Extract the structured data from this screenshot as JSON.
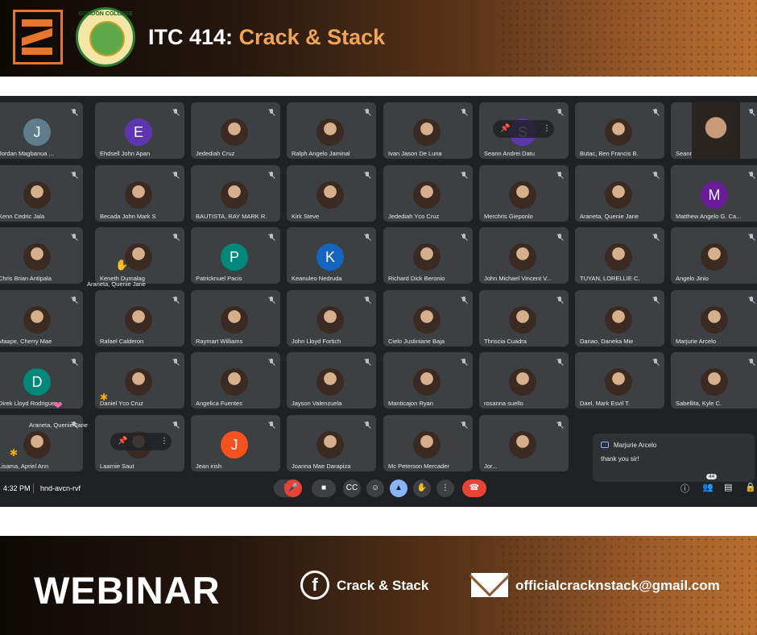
{
  "header": {
    "title_prefix": "ITC 414:",
    "title_accent": "Crack & Stack",
    "seal_text": "GORDON COLLEGE"
  },
  "participants": [
    {
      "name": "Jordan Magbanua ...",
      "initial": "J",
      "color": "#5f7d8c",
      "photo": false
    },
    {
      "name": "Ehdsell John Apan",
      "initial": "E",
      "color": "#5e35b1",
      "photo": false
    },
    {
      "name": "Jedediah Cruz",
      "initial": "",
      "color": "",
      "photo": true
    },
    {
      "name": "Ralph Angelo Jaminal",
      "initial": "",
      "color": "",
      "photo": true
    },
    {
      "name": "Ivan Jason De Luna",
      "initial": "",
      "color": "",
      "photo": true
    },
    {
      "name": "Seann Andrei Datu",
      "initial": "S",
      "color": "#5e35b1",
      "photo": false
    },
    {
      "name": "Butac, Ben Francis B.",
      "initial": "",
      "color": "",
      "photo": true
    },
    {
      "name": "Seann Andrei Datu",
      "initial": "",
      "color": "",
      "photo": true
    },
    {
      "name": "Kenn Cedric Jala",
      "initial": "",
      "color": "",
      "photo": true
    },
    {
      "name": "Becada John Mark S",
      "initial": "",
      "color": "",
      "photo": true
    },
    {
      "name": "BAUTISTA, RAY MARK R.",
      "initial": "",
      "color": "",
      "photo": true
    },
    {
      "name": "Kirk Steve",
      "initial": "",
      "color": "",
      "photo": true
    },
    {
      "name": "Jedediah Yco Cruz",
      "initial": "",
      "color": "",
      "photo": true
    },
    {
      "name": "Merchris Gieponlo",
      "initial": "",
      "color": "",
      "photo": true
    },
    {
      "name": "Araneta, Quenie Jane",
      "initial": "",
      "color": "",
      "photo": true
    },
    {
      "name": "Matthew Angelo G. Ca...",
      "initial": "M",
      "color": "#6a1b9a",
      "photo": false
    },
    {
      "name": "Chris Brian Antipala",
      "initial": "",
      "color": "",
      "photo": true
    },
    {
      "name": "Keneth Dumalag",
      "initial": "",
      "color": "",
      "photo": true
    },
    {
      "name": "Patricknuel Pacis",
      "initial": "P",
      "color": "#00897b",
      "photo": false
    },
    {
      "name": "Keanuleo Nedruda",
      "initial": "K",
      "color": "#1565c0",
      "photo": false
    },
    {
      "name": "Richard Dick Beronio",
      "initial": "",
      "color": "",
      "photo": true
    },
    {
      "name": "John Michael Vincent V...",
      "initial": "",
      "color": "",
      "photo": true
    },
    {
      "name": "TUYAN, LORELLIE C.",
      "initial": "",
      "color": "",
      "photo": true
    },
    {
      "name": "Angelo Jinio",
      "initial": "",
      "color": "",
      "photo": true
    },
    {
      "name": "Maape, Cherry Mae",
      "initial": "",
      "color": "",
      "photo": true
    },
    {
      "name": "Rafael Calderon",
      "initial": "",
      "color": "",
      "photo": true
    },
    {
      "name": "Raymart Williams",
      "initial": "",
      "color": "",
      "photo": true
    },
    {
      "name": "John Lloyd Fortich",
      "initial": "",
      "color": "",
      "photo": true
    },
    {
      "name": "Cielo Justiniane Baja",
      "initial": "",
      "color": "",
      "photo": true
    },
    {
      "name": "Thriscia Cuadra",
      "initial": "",
      "color": "",
      "photo": true
    },
    {
      "name": "Danao, Daneka Mie",
      "initial": "",
      "color": "",
      "photo": true
    },
    {
      "name": "Marjurie Arcelo",
      "initial": "",
      "color": "",
      "photo": true
    },
    {
      "name": "Direk Lloyd Rodriguez",
      "initial": "D",
      "color": "#00897b",
      "photo": false
    },
    {
      "name": "Daniel Yco Cruz",
      "initial": "",
      "color": "",
      "photo": true
    },
    {
      "name": "Angelica Fuentes",
      "initial": "",
      "color": "",
      "photo": true
    },
    {
      "name": "Jayson Valenzuela",
      "initial": "",
      "color": "",
      "photo": true
    },
    {
      "name": "Manticajon Ryan",
      "initial": "",
      "color": "",
      "photo": true
    },
    {
      "name": "rosanna suello",
      "initial": "",
      "color": "",
      "photo": true
    },
    {
      "name": "Dael, Mark Esvil T.",
      "initial": "",
      "color": "",
      "photo": true
    },
    {
      "name": "Sabellita, Kyle C.",
      "initial": "",
      "color": "",
      "photo": true
    },
    {
      "name": "Lisama, Apriel Ann",
      "initial": "",
      "color": "",
      "photo": true
    },
    {
      "name": "Laarnie Saut",
      "initial": "",
      "color": "",
      "photo": true
    },
    {
      "name": "Jean irish",
      "initial": "J",
      "color": "#f4511e",
      "photo": false
    },
    {
      "name": "Joanna Mae Darapiza",
      "initial": "",
      "color": "",
      "photo": true
    },
    {
      "name": "Mc Peterson Mercader",
      "initial": "",
      "color": "",
      "photo": true
    },
    {
      "name": "Jor...",
      "initial": "",
      "color": "",
      "photo": true
    }
  ],
  "reaction_tags": {
    "tag1": "Araneta, Quenie Jane",
    "tag2": "Araneta, Quenie Jane"
  },
  "chat": {
    "sender": "Marjurie Arcelo",
    "message": "thank you sir!"
  },
  "toolbar": {
    "time": "4:32 PM",
    "meeting_code": "hnd-avcn-rvf",
    "participant_count": "44"
  },
  "footer": {
    "webinar": "WEBINAR",
    "facebook": "Crack & Stack",
    "email": "officialcracknstack@gmail.com"
  },
  "icons": [
    "mic-off-icon",
    "camera-icon",
    "captions-icon",
    "emoji-icon",
    "present-icon",
    "raise-hand-icon",
    "more-icon",
    "end-call-icon",
    "info-icon",
    "people-icon",
    "chat-icon",
    "lock-icon",
    "pin-icon"
  ]
}
